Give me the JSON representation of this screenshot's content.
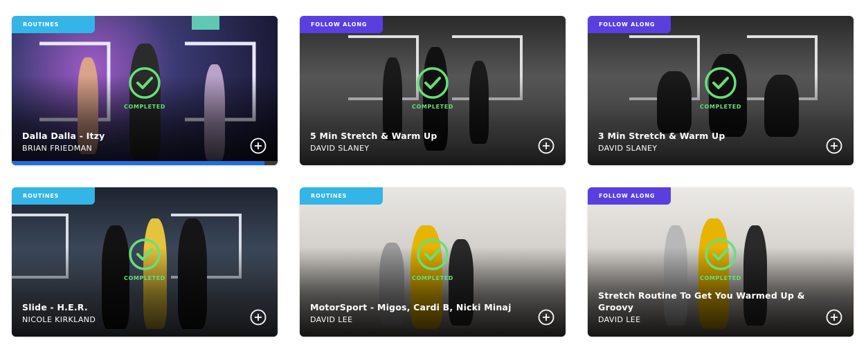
{
  "completed_label": "COMPLETED",
  "colors": {
    "routines": "#33b5e8",
    "follow_along": "#5a3ee0",
    "check": "#66e07a",
    "progress": "#1f6fe0"
  },
  "cards": [
    {
      "badge": "ROUTINES",
      "badge_type": "routines",
      "title": "Dalla Dalla - Itzy",
      "author": "BRIAN FRIEDMAN",
      "progress": 0.95
    },
    {
      "badge": "FOLLOW ALONG",
      "badge_type": "follow",
      "title": "5 Min Stretch & Warm Up",
      "author": "DAVID SLANEY"
    },
    {
      "badge": "FOLLOW ALONG",
      "badge_type": "follow",
      "title": "3 Min Stretch & Warm Up",
      "author": "DAVID SLANEY"
    },
    {
      "badge": "ROUTINES",
      "badge_type": "routines",
      "title": "Slide - H.E.R.",
      "author": "NICOLE KIRKLAND"
    },
    {
      "badge": "ROUTINES",
      "badge_type": "routines",
      "title": "MotorSport - Migos, Cardi B, Nicki Minaj",
      "author": "DAVID LEE"
    },
    {
      "badge": "FOLLOW ALONG",
      "badge_type": "follow",
      "title": "Stretch Routine To Get You Warmed Up & Groovy",
      "author": "DAVID LEE"
    }
  ]
}
